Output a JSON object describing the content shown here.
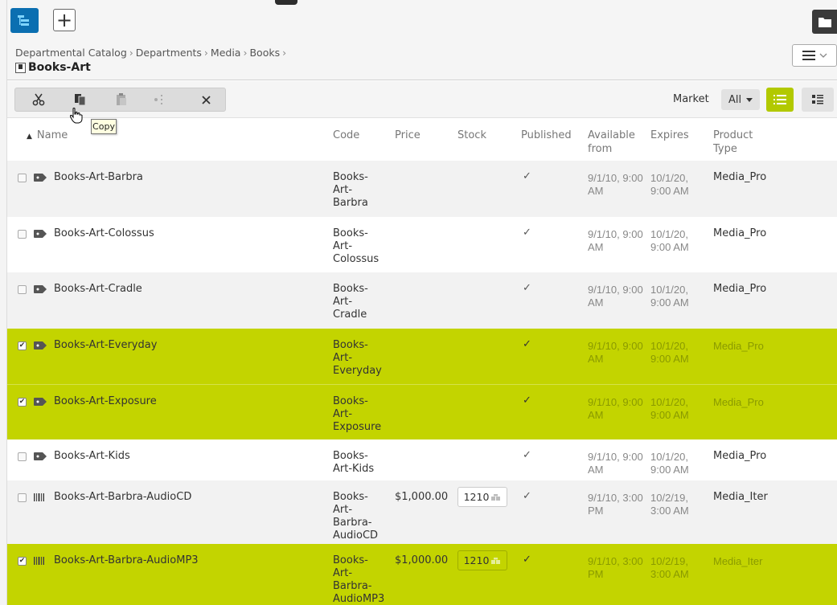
{
  "top_bar": {
    "tree_icon": "tree-view-icon",
    "add_label": "+",
    "folder_icon": "folder-icon"
  },
  "header": {
    "breadcrumb": [
      "Departmental Catalog",
      "Departments",
      "Media",
      "Books"
    ],
    "breadcrumb_separator": "›",
    "title": "Books-Art",
    "title_icon": "catalog-node-icon"
  },
  "toolbar": {
    "tools": [
      {
        "name": "cut",
        "icon": "scissors-icon"
      },
      {
        "name": "copy",
        "icon": "copy-icon"
      },
      {
        "name": "paste",
        "icon": "paste-icon"
      },
      {
        "name": "link",
        "icon": "link-icon"
      },
      {
        "name": "delete",
        "icon": "close-icon"
      }
    ],
    "market_label": "Market",
    "market_value": "All",
    "tooltip": "Copy"
  },
  "columns": {
    "name": "Name",
    "code": "Code",
    "price": "Price",
    "stock": "Stock",
    "published": "Published",
    "available": "Available from",
    "expires": "Expires",
    "product_type": "Product Type"
  },
  "rows": [
    {
      "name": "Books-Art-Barbra",
      "type": "product",
      "code": "Books-Art-Barbra",
      "price": "",
      "stock": "",
      "published": "✓",
      "available": "9/1/10, 9:00 AM",
      "expires": "10/1/20, 9:00 AM",
      "ptype": "Media_Pro",
      "selected": false
    },
    {
      "name": "Books-Art-Colossus",
      "type": "product",
      "code": "Books-Art-Colossus",
      "price": "",
      "stock": "",
      "published": "✓",
      "available": "9/1/10, 9:00 AM",
      "expires": "10/1/20, 9:00 AM",
      "ptype": "Media_Pro",
      "selected": false
    },
    {
      "name": "Books-Art-Cradle",
      "type": "product",
      "code": "Books-Art-Cradle",
      "price": "",
      "stock": "",
      "published": "✓",
      "available": "9/1/10, 9:00 AM",
      "expires": "10/1/20, 9:00 AM",
      "ptype": "Media_Pro",
      "selected": false
    },
    {
      "name": "Books-Art-Everyday",
      "type": "product",
      "code": "Books-Art-Everyday",
      "price": "",
      "stock": "",
      "published": "✓",
      "available": "9/1/10, 9:00 AM",
      "expires": "10/1/20, 9:00 AM",
      "ptype": "Media_Pro",
      "selected": true
    },
    {
      "name": "Books-Art-Exposure",
      "type": "product",
      "code": "Books-Art-Exposure",
      "price": "",
      "stock": "",
      "published": "✓",
      "available": "9/1/10, 9:00 AM",
      "expires": "10/1/20, 9:00 AM",
      "ptype": "Media_Pro",
      "selected": true
    },
    {
      "name": "Books-Art-Kids",
      "type": "product",
      "code": "Books-Art-Kids",
      "price": "",
      "stock": "",
      "published": "✓",
      "available": "9/1/10, 9:00 AM",
      "expires": "10/1/20, 9:00 AM",
      "ptype": "Media_Pro",
      "selected": false
    },
    {
      "name": "Books-Art-Barbra-AudioCD",
      "type": "variant",
      "code": "Books-Art-Barbra-AudioCD",
      "price": "$1,000.00",
      "stock": "1210",
      "published": "✓",
      "available": "9/1/10, 3:00 PM",
      "expires": "10/2/19, 3:00 AM",
      "ptype": "Media_Iter",
      "selected": false
    },
    {
      "name": "Books-Art-Barbra-AudioMP3",
      "type": "variant",
      "code": "Books-Art-Barbra-AudioMP3",
      "price": "$1,000.00",
      "stock": "1210",
      "published": "✓",
      "available": "9/1/10, 3:00 PM",
      "expires": "10/2/19, 3:00 AM",
      "ptype": "Media_Iter",
      "selected": true
    }
  ],
  "colors": {
    "accent_blue": "#0b6fb1",
    "selected_row": "#c3d400",
    "active_view_button": "#b2c900"
  }
}
